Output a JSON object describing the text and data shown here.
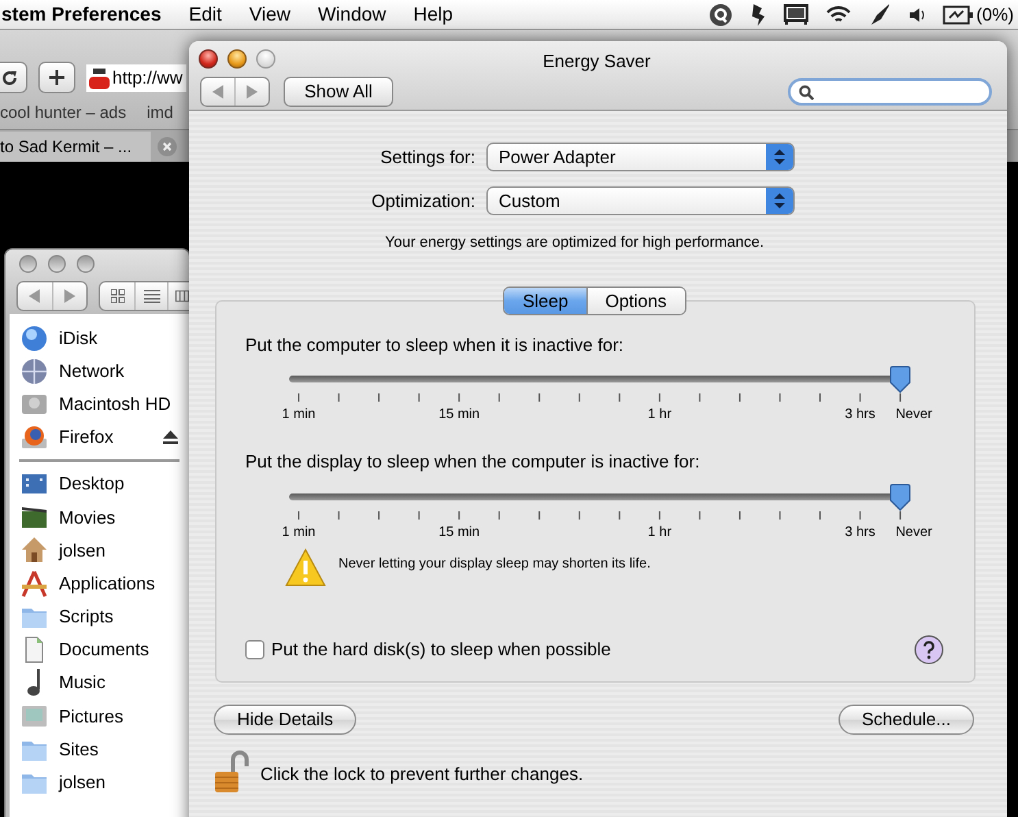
{
  "menu_bar": {
    "app_name": "stem Preferences",
    "menus": [
      "Edit",
      "View",
      "Window",
      "Help"
    ],
    "battery": "(0%)"
  },
  "browser_window": {
    "url": "http://ww",
    "bookmarks": [
      "cool hunter – ads",
      "imd"
    ],
    "tab": "to Sad Kermit – ..."
  },
  "finder_window": {
    "devices": [
      {
        "label": "iDisk",
        "eject": false
      },
      {
        "label": "Network",
        "eject": false
      },
      {
        "label": "Macintosh HD",
        "eject": false
      },
      {
        "label": "Firefox",
        "eject": true
      }
    ],
    "places": [
      "Desktop",
      "Movies",
      "jolsen",
      "Applications",
      "Scripts",
      "Documents",
      "Music",
      "Pictures",
      "Sites",
      "jolsen"
    ]
  },
  "energy_saver": {
    "title": "Energy Saver",
    "show_all": "Show All",
    "settings_for": {
      "label": "Settings for:",
      "value": "Power Adapter"
    },
    "optimization": {
      "label": "Optimization:",
      "value": "Custom"
    },
    "status": "Your energy settings are optimized for high performance.",
    "tabs": [
      {
        "label": "Sleep",
        "selected": true
      },
      {
        "label": "Options",
        "selected": false
      }
    ],
    "sliders": [
      {
        "label": "Put the computer to sleep when it is inactive for:",
        "level": 1,
        "ticks": [
          "1 min",
          "15 min",
          "1 hr",
          "3 hrs",
          "Never"
        ]
      },
      {
        "label": "Put the display to sleep when the computer is inactive for:",
        "level": 1,
        "ticks": [
          "1 min",
          "15 min",
          "1 hr",
          "3 hrs",
          "Never"
        ]
      }
    ],
    "warning": "Never letting your display sleep may shorten its life.",
    "hard_disk_sleep": {
      "label": "Put the hard disk(s) to sleep when possible",
      "checked": false
    },
    "buttons": [
      "Hide Details",
      "Schedule..."
    ],
    "lock": {
      "text": "Click the lock to prevent further changes.",
      "locked": false
    }
  }
}
